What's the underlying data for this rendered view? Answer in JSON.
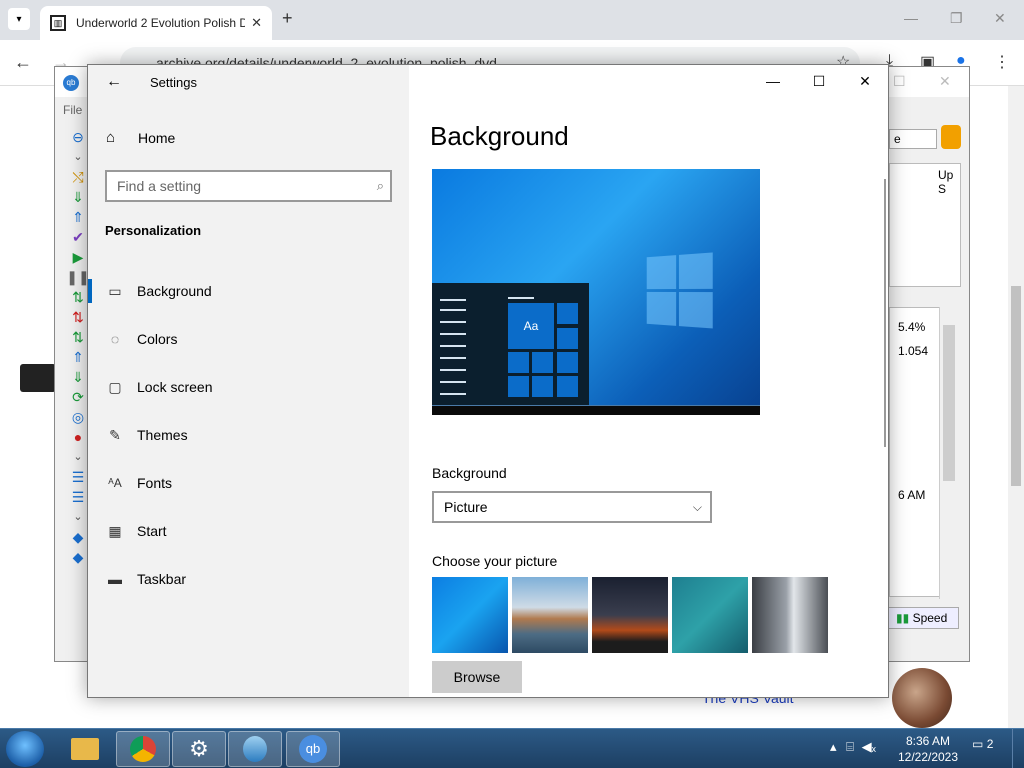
{
  "chrome": {
    "tab_title": "Underworld 2 Evolution Polish D",
    "tab_close": "✕",
    "new_tab": "+",
    "url": "archive.org/details/underworld_2_evolution_polish_dvd",
    "page_link": "The VHS Vault"
  },
  "qbittorrent": {
    "menu_file": "File",
    "combo_value": "e",
    "col_up": "Up S",
    "stat_ratio": "5.4%",
    "stat_value": "1.054",
    "stat_time": "6 AM",
    "speed_btn": "Speed"
  },
  "settings": {
    "window_title": "Settings",
    "home": "Home",
    "search_placeholder": "Find a setting",
    "section": "Personalization",
    "nav": [
      {
        "label": "Background",
        "icon": "picture-icon"
      },
      {
        "label": "Colors",
        "icon": "palette-icon"
      },
      {
        "label": "Lock screen",
        "icon": "lock-screen-icon"
      },
      {
        "label": "Themes",
        "icon": "themes-icon"
      },
      {
        "label": "Fonts",
        "icon": "fonts-icon"
      },
      {
        "label": "Start",
        "icon": "start-icon"
      },
      {
        "label": "Taskbar",
        "icon": "taskbar-icon"
      }
    ],
    "page_title": "Background",
    "preview_tile_text": "Aa",
    "background_label": "Background",
    "background_value": "Picture",
    "choose_label": "Choose your picture",
    "browse": "Browse"
  },
  "taskbar": {
    "time": "8:36 AM",
    "date": "12/22/2023",
    "notification_count": "2"
  }
}
